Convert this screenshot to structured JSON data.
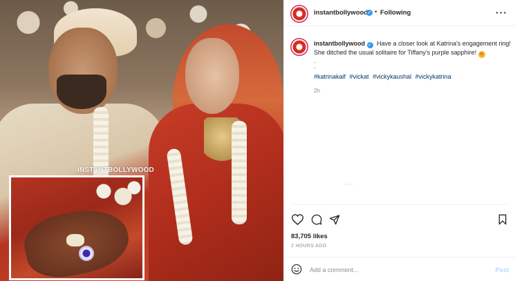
{
  "post": {
    "watermark": "INSTANTBOLLYWOOD"
  },
  "header": {
    "username": "instantbollywood",
    "verified_mark": "✓",
    "separator": "•",
    "follow_label": "Following",
    "more_icon": "more-options-icon",
    "more_glyph": "···"
  },
  "caption": {
    "username": "instantbollywood",
    "verified_mark": "✓",
    "text": "Have a closer look at Katrina's engagement ring! She ditched the usual solitaire for Tiffany's purple sapphire!",
    "emoji": "☺",
    "dots": [
      ".",
      "."
    ],
    "hashtags": [
      "#katrinakaif",
      "#vickat",
      "#vickykaushal",
      "#vickykatrina"
    ],
    "time": "2h"
  },
  "actions": {
    "like_icon": "heart-icon",
    "comment_icon": "comment-icon",
    "share_icon": "share-icon",
    "save_icon": "bookmark-icon"
  },
  "likes": "83,705 likes",
  "ago": "2 HOURS AGO",
  "comment_bar": {
    "emoji_icon": "emoji-icon",
    "placeholder": "Add a comment...",
    "post_label": "Post"
  },
  "colors": {
    "link": "#00376b",
    "verified": "#3897f0",
    "post_disabled": "#b3dbff",
    "muted": "#8e8e8e"
  }
}
